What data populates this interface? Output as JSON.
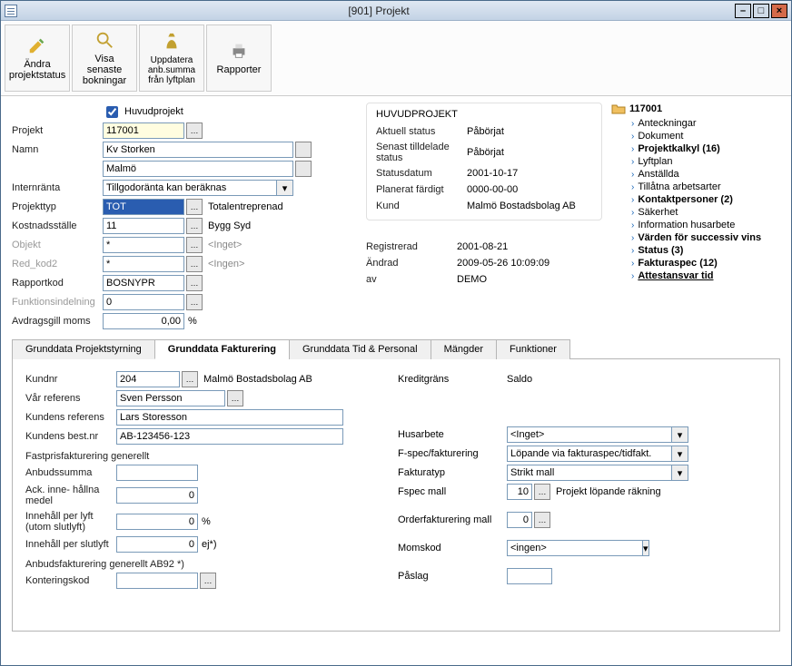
{
  "window": {
    "title": "[901]  Projekt"
  },
  "toolbar": {
    "btn1": "Ändra projektstatus",
    "btn2": "Visa senaste bokningar",
    "btn3": "Uppdatera anb.summa från lyftplan",
    "btn4": "Rapporter"
  },
  "form": {
    "huvudprojekt_label": "Huvudprojekt",
    "projekt_label": "Projekt",
    "projekt_value": "117001",
    "namn_label": "Namn",
    "namn_value1": "Kv Storken",
    "namn_value2": "Malmö",
    "internranta_label": "Internränta",
    "internranta_value": "Tillgodoränta kan beräknas",
    "projekttyp_label": "Projekttyp",
    "projekttyp_value": "TOT",
    "projekttyp_extra": "Totalentreprenad",
    "kostnadsstalle_label": "Kostnadsställe",
    "kostnadsstalle_value": "11",
    "kostnadsstalle_extra": "Bygg Syd",
    "objekt_label": "Objekt",
    "objekt_value": "*",
    "objekt_extra": "<Inget>",
    "redkod2_label": "Red_kod2",
    "redkod2_value": "*",
    "redkod2_extra": "<Ingen>",
    "rapportkod_label": "Rapportkod",
    "rapportkod_value": "BOSNYPR",
    "funktionsindelning_label": "Funktionsindelning",
    "funktionsindelning_value": "0",
    "avdragsgill_label": "Avdragsgill moms",
    "avdragsgill_value": "0,00",
    "avdragsgill_unit": "%"
  },
  "status": {
    "header": "HUVUDPROJEKT",
    "aktuell_l": "Aktuell status",
    "aktuell_v": "Påbörjat",
    "senast_l": "Senast tilldelade status",
    "senast_v": "Påbörjat",
    "statusdatum_l": "Statusdatum",
    "statusdatum_v": "2001-10-17",
    "planerat_l": "Planerat färdigt",
    "planerat_v": "0000-00-00",
    "kund_l": "Kund",
    "kund_v": "Malmö Bostadsbolag AB",
    "reg_l": "Registrerad",
    "reg_v": "2001-08-21",
    "andrad_l": "Ändrad",
    "andrad_v": "2009-05-26 10:09:09",
    "av_l": "av",
    "av_v": "DEMO"
  },
  "tree": {
    "root": "117001",
    "items": [
      {
        "label": "Anteckningar",
        "style": ""
      },
      {
        "label": "Dokument",
        "style": ""
      },
      {
        "label": "Projektkalkyl (16)",
        "style": "bold"
      },
      {
        "label": "Lyftplan",
        "style": ""
      },
      {
        "label": "Anställda",
        "style": ""
      },
      {
        "label": "Tillåtna arbetsarter",
        "style": ""
      },
      {
        "label": "Kontaktpersoner (2)",
        "style": "bold"
      },
      {
        "label": "Säkerhet",
        "style": ""
      },
      {
        "label": "Information husarbete",
        "style": ""
      },
      {
        "label": "Värden för successiv vins",
        "style": "bold"
      },
      {
        "label": "Status (3)",
        "style": "bold"
      },
      {
        "label": "Fakturaspec (12)",
        "style": "bold"
      },
      {
        "label": "Attestansvar tid",
        "style": "underlined"
      }
    ]
  },
  "tabs": {
    "t1": "Grunddata Projektstyrning",
    "t2": "Grunddata Fakturering",
    "t3": "Grunddata Tid & Personal",
    "t4": "Mängder",
    "t5": "Funktioner"
  },
  "fakt": {
    "kundnr_l": "Kundnr",
    "kundnr_v": "204",
    "kundnr_name": "Malmö Bostadsbolag AB",
    "varref_l": "Vår referens",
    "varref_v": "Sven Persson",
    "kundref_l": "Kundens referens",
    "kundref_v": "Lars Storesson",
    "bestnr_l": "Kundens best.nr",
    "bestnr_v": "AB-123456-123",
    "fastpris_header": "Fastprisfakturering generellt",
    "anbud_l": "Anbudssumma",
    "anbud_v": "",
    "ack_l": "Ack. inne- hållna medel",
    "ack_v": "0",
    "innehlyft_l": "Innehåll per lyft (utom slutlyft)",
    "innehlyft_v": "0",
    "innehlyft_u": "%",
    "innehslut_l": "Innehåll per slutlyft",
    "innehslut_v": "0",
    "innehslut_u": "ej*)",
    "ab92_header": "Anbudsfakturering generellt AB92  *)",
    "konter_l": "Konteringskod",
    "konter_v": "",
    "kreditgrans_l": "Kreditgräns",
    "saldo_l": "Saldo",
    "husarbete_l": "Husarbete",
    "husarbete_v": "<Inget>",
    "fspec_l": "F-spec/fakturering",
    "fspec_v": "Löpande via fakturaspec/tidfakt.",
    "fakturatyp_l": "Fakturatyp",
    "fakturatyp_v": "Strikt mall",
    "fspecmall_l": "Fspec mall",
    "fspecmall_v": "10",
    "fspecmall_name": "Projekt löpande räkning",
    "orderfakt_l": "Orderfakturering mall",
    "orderfakt_v": "0",
    "momskod_l": "Momskod",
    "momskod_v": "<ingen>",
    "paslag_l": "Påslag",
    "paslag_v": ""
  }
}
